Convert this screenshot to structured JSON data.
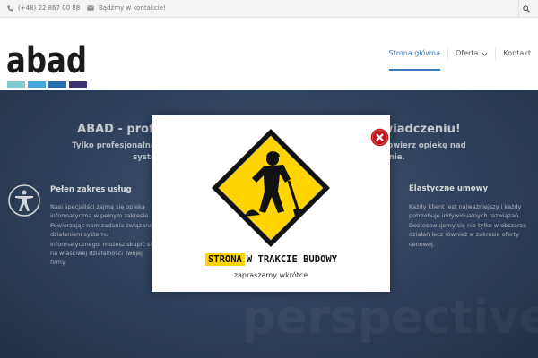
{
  "topbar": {
    "phone": "(+48) 22 867 00 88",
    "separator": "/",
    "contact_text": "Bądźmy w kontakcie!",
    "icons": [
      "phone-icon",
      "envelope-icon",
      "search-icon"
    ]
  },
  "header": {
    "logo_text": "abad",
    "logo_colors": [
      "#7fcbd0",
      "#43a8dd",
      "#2a6db0",
      "#3c3372"
    ],
    "nav": [
      {
        "label": "Strona główna"
      },
      {
        "label": "Oferta"
      },
      {
        "label": "Kontakt"
      }
    ],
    "accent": "#3a7bbf"
  },
  "hero": {
    "title": "ABAD - profesjonal                                   aj doświadczeniu!",
    "subtitle_line1": "Tylko profesjonalna obsługa inf                                                  aktury IT. Powierz opiekę nad",
    "subtitle_line2": "systemami swoje                                                  doświadczenie.",
    "watermark": "perspective",
    "feature_left": {
      "title": "Pełen zakres usług",
      "text": "Nasi specjaliści zajmą się opieką informatyczną w pełnym zakresie. Powierzając nam zadania związane z działaniem systemu informatycznego, możesz skupić się na właściwej działalności Twojej firmy."
    },
    "feature_right": {
      "title": "Elastyczne umowy",
      "text": "Każdy klient jest najważniejszy i każdy potrzebuje indywidualnych rozwiązań. Dostosowujemy się nie tylko w obszarze działań lecz również w zakresie oferty cenowej."
    }
  },
  "popup": {
    "banner_highlight": "STRONA",
    "banner_rest": "W TRAKCIE BUDOWY",
    "invite": "zapraszamy wkrótce",
    "sign_color": "#ffd400",
    "close_color": "#c0151b"
  }
}
